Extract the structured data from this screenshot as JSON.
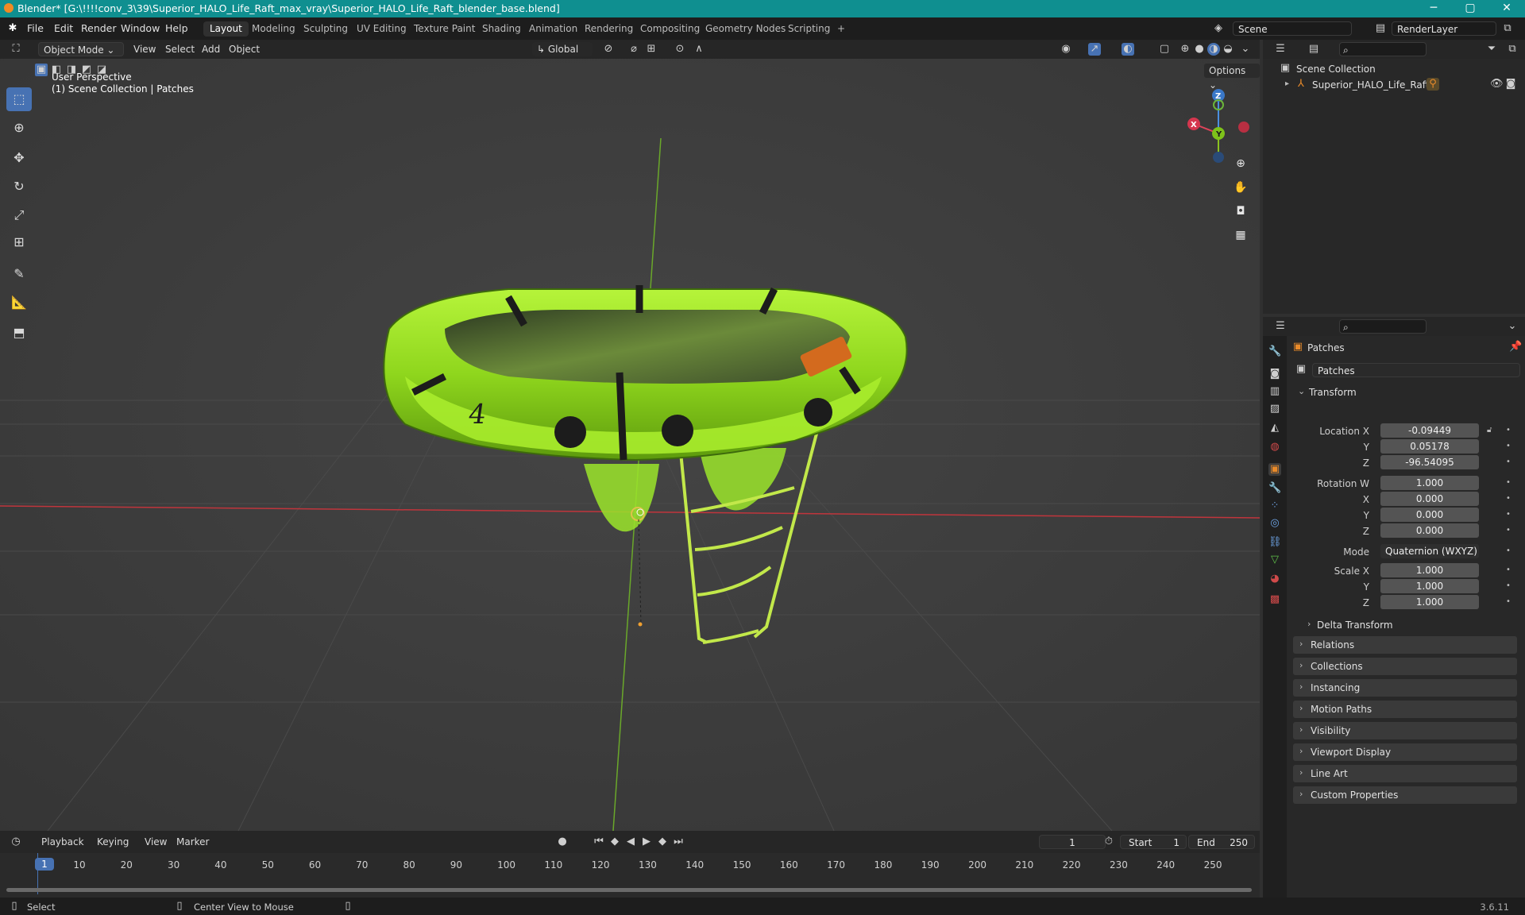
{
  "window": {
    "title": "Blender* [G:\\!!!!conv_3\\39\\Superior_HALO_Life_Raft_max_vray\\Superior_HALO_Life_Raft_blender_base.blend]",
    "minimize": "─",
    "maximize": "▢",
    "close": "✕"
  },
  "menu": [
    "File",
    "Edit",
    "Render",
    "Window",
    "Help"
  ],
  "workspaces": [
    "Layout",
    "Modeling",
    "Sculpting",
    "UV Editing",
    "Texture Paint",
    "Shading",
    "Animation",
    "Rendering",
    "Compositing",
    "Geometry Nodes",
    "Scripting",
    "+"
  ],
  "active_workspace": "Layout",
  "scene_field": "Scene",
  "renderlayer_field": "RenderLayer",
  "viewport_header": {
    "mode": "Object Mode",
    "menus": [
      "View",
      "Select",
      "Add",
      "Object"
    ],
    "orientation": "Global",
    "options": "Options"
  },
  "viewport": {
    "perspective": "User Perspective",
    "collection_info": "(1) Scene Collection | Patches",
    "gizmo": {
      "x": "X",
      "y": "Y",
      "z": "Z"
    },
    "raft_number": "4"
  },
  "outliner": {
    "root": "Scene Collection",
    "items": [
      "Superior_HALO_Life_Raft"
    ]
  },
  "properties": {
    "object_name": "Patches",
    "data_name": "Patches",
    "transform_label": "Transform",
    "location": {
      "label": "Location X",
      "x": "-0.09449",
      "y": "0.05178",
      "z": "-96.54095"
    },
    "rotation": {
      "label": "Rotation W",
      "w": "1.000",
      "x": "0.000",
      "y": "0.000",
      "z": "0.000"
    },
    "mode_label": "Mode",
    "mode_value": "Quaternion (WXYZ)",
    "scale": {
      "label": "Scale X",
      "x": "1.000",
      "y": "1.000",
      "z": "1.000"
    },
    "axis": {
      "y": "Y",
      "z": "Z",
      "x": "X"
    },
    "delta": "Delta Transform",
    "panels": [
      "Relations",
      "Collections",
      "Instancing",
      "Motion Paths",
      "Visibility",
      "Viewport Display",
      "Line Art",
      "Custom Properties"
    ]
  },
  "timeline": {
    "menus": [
      "Playback",
      "Keying",
      "View",
      "Marker"
    ],
    "current_frame": "1",
    "start_label": "Start",
    "start_value": "1",
    "end_label": "End",
    "end_value": "250",
    "ticks": [
      "1",
      "10",
      "20",
      "30",
      "40",
      "50",
      "60",
      "70",
      "80",
      "90",
      "100",
      "110",
      "120",
      "130",
      "140",
      "150",
      "160",
      "170",
      "180",
      "190",
      "200",
      "210",
      "220",
      "230",
      "240",
      "250"
    ]
  },
  "status": {
    "select": "Select",
    "center": "Center View to Mouse",
    "version": "3.6.11"
  }
}
